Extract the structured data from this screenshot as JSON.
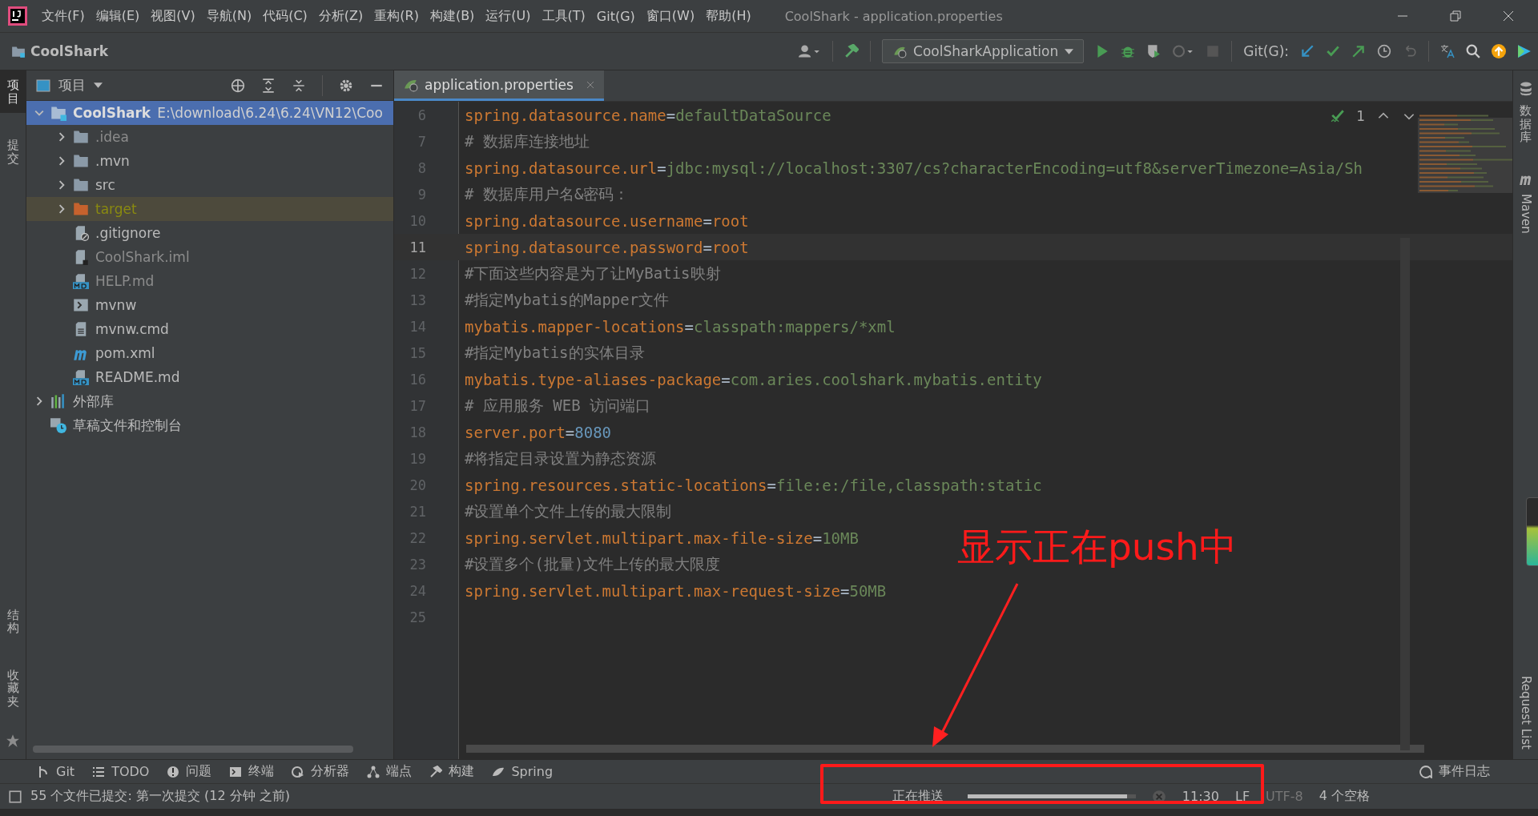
{
  "window": {
    "title": "CoolShark - application.properties"
  },
  "menu": [
    "文件(F)",
    "编辑(E)",
    "视图(V)",
    "导航(N)",
    "代码(C)",
    "分析(Z)",
    "重构(R)",
    "构建(B)",
    "运行(U)",
    "工具(T)",
    "Git(G)",
    "窗口(W)",
    "帮助(H)"
  ],
  "toolbar": {
    "project": "CoolShark",
    "run_config": "CoolSharkApplication",
    "git_label": "Git(G):"
  },
  "left_strip": {
    "top": [
      {
        "label": "项目",
        "selected": true
      },
      {
        "label": "提交",
        "selected": false
      }
    ],
    "bottom": [
      {
        "label": "结构",
        "selected": false
      },
      {
        "label": "收藏夹",
        "selected": false
      }
    ]
  },
  "project": {
    "title": "项目",
    "tree": [
      {
        "name": "CoolShark",
        "path": "E:\\download\\6.24\\6.24\\VN12\\Coo",
        "kind": "module",
        "dimmed": false,
        "selected": true,
        "expanded": true,
        "children": [
          {
            "name": ".idea",
            "kind": "folder",
            "dimmed": true,
            "selected": false,
            "expanded": false
          },
          {
            "name": ".mvn",
            "kind": "folder",
            "dimmed": false,
            "selected": false,
            "expanded": false
          },
          {
            "name": "src",
            "kind": "folder",
            "dimmed": false,
            "selected": false,
            "expanded": false
          },
          {
            "name": "target",
            "kind": "excluded",
            "dimmed": false,
            "selected": false,
            "expanded": false
          },
          {
            "name": ".gitignore",
            "kind": "gitignore",
            "dimmed": false,
            "selected": false
          },
          {
            "name": "CoolShark.iml",
            "kind": "iml",
            "dimmed": true,
            "selected": false
          },
          {
            "name": "HELP.md",
            "kind": "md",
            "dimmed": true,
            "selected": false
          },
          {
            "name": "mvnw",
            "kind": "shell",
            "dimmed": false,
            "selected": false
          },
          {
            "name": "mvnw.cmd",
            "kind": "text",
            "dimmed": false,
            "selected": false
          },
          {
            "name": "pom.xml",
            "kind": "maven",
            "dimmed": false,
            "selected": false
          },
          {
            "name": "README.md",
            "kind": "md",
            "dimmed": false,
            "selected": false
          }
        ]
      },
      {
        "name": "外部库",
        "kind": "library",
        "dimmed": false,
        "selected": false,
        "expanded": false
      },
      {
        "name": "草稿文件和控制台",
        "kind": "scratch",
        "dimmed": false,
        "selected": false
      }
    ]
  },
  "editor": {
    "tab": {
      "label": "application.properties",
      "selected": true
    },
    "inspection_count": "1",
    "lines": [
      {
        "number": "6",
        "current": false,
        "tokens": [
          {
            "kind": "key",
            "text": "spring.datasource.name"
          },
          {
            "kind": "sep",
            "text": "="
          },
          {
            "kind": "value",
            "text": "defaultDataSource"
          }
        ]
      },
      {
        "number": "7",
        "current": false,
        "tokens": [
          {
            "kind": "comment",
            "text": "# 数据库连接地址"
          }
        ]
      },
      {
        "number": "8",
        "current": false,
        "tokens": [
          {
            "kind": "key",
            "text": "spring.datasource.url"
          },
          {
            "kind": "sep",
            "text": "="
          },
          {
            "kind": "value",
            "text": "jdbc:mysql://localhost:3307/cs?characterEncoding=utf8&serverTimezone=Asia/Sh"
          }
        ]
      },
      {
        "number": "9",
        "current": false,
        "tokens": [
          {
            "kind": "comment",
            "text": "# 数据库用户名&密码："
          }
        ]
      },
      {
        "number": "10",
        "current": false,
        "tokens": [
          {
            "kind": "key",
            "text": "spring.datasource.username"
          },
          {
            "kind": "sep",
            "text": "="
          },
          {
            "kind": "reserved",
            "text": "root"
          }
        ]
      },
      {
        "number": "11",
        "current": true,
        "tokens": [
          {
            "kind": "key",
            "text": "spring.datasource.password"
          },
          {
            "kind": "sep",
            "text": "="
          },
          {
            "kind": "reserved",
            "text": "root"
          }
        ]
      },
      {
        "number": "12",
        "current": false,
        "tokens": [
          {
            "kind": "comment",
            "text": "#下面这些内容是为了让MyBatis映射"
          }
        ]
      },
      {
        "number": "13",
        "current": false,
        "tokens": [
          {
            "kind": "comment",
            "text": "#指定Mybatis的Mapper文件"
          }
        ]
      },
      {
        "number": "14",
        "current": false,
        "tokens": [
          {
            "kind": "key",
            "text": "mybatis.mapper-locations"
          },
          {
            "kind": "sep",
            "text": "="
          },
          {
            "kind": "value",
            "text": "classpath:mappers/*xml"
          }
        ]
      },
      {
        "number": "15",
        "current": false,
        "tokens": [
          {
            "kind": "comment",
            "text": "#指定Mybatis的实体目录"
          }
        ]
      },
      {
        "number": "16",
        "current": false,
        "tokens": [
          {
            "kind": "key",
            "text": "mybatis.type-aliases-package"
          },
          {
            "kind": "sep",
            "text": "="
          },
          {
            "kind": "value",
            "text": "com.aries.coolshark.mybatis.entity"
          }
        ]
      },
      {
        "number": "17",
        "current": false,
        "tokens": [
          {
            "kind": "comment",
            "text": "# 应用服务 WEB 访问端口"
          }
        ]
      },
      {
        "number": "18",
        "current": false,
        "tokens": [
          {
            "kind": "key",
            "text": "server.port"
          },
          {
            "kind": "sep",
            "text": "="
          },
          {
            "kind": "number",
            "text": "8080"
          }
        ]
      },
      {
        "number": "19",
        "current": false,
        "tokens": [
          {
            "kind": "comment",
            "text": "#将指定目录设置为静态资源"
          }
        ]
      },
      {
        "number": "20",
        "current": false,
        "tokens": [
          {
            "kind": "key",
            "text": "spring.resources.static-locations"
          },
          {
            "kind": "sep",
            "text": "="
          },
          {
            "kind": "value",
            "text": "file:e:/file,classpath:static"
          }
        ]
      },
      {
        "number": "21",
        "current": false,
        "tokens": [
          {
            "kind": "comment",
            "text": "#设置单个文件上传的最大限制"
          }
        ]
      },
      {
        "number": "22",
        "current": false,
        "tokens": [
          {
            "kind": "key",
            "text": "spring.servlet.multipart.max-file-size"
          },
          {
            "kind": "sep",
            "text": "="
          },
          {
            "kind": "value",
            "text": "10MB"
          }
        ]
      },
      {
        "number": "23",
        "current": false,
        "tokens": [
          {
            "kind": "comment",
            "text": "#设置多个(批量)文件上传的最大限度"
          }
        ]
      },
      {
        "number": "24",
        "current": false,
        "tokens": [
          {
            "kind": "key",
            "text": "spring.servlet.multipart.max-request-size"
          },
          {
            "kind": "sep",
            "text": "="
          },
          {
            "kind": "value",
            "text": "50MB"
          }
        ]
      },
      {
        "number": "25",
        "current": false
      }
    ]
  },
  "right_strip": [
    {
      "label": "数据库",
      "kind": "cjk"
    },
    {
      "label": "Maven",
      "kind": "latin"
    },
    {
      "label": "Request List",
      "kind": "latin"
    }
  ],
  "tool_windows": [
    {
      "label": "Git",
      "kind": "git"
    },
    {
      "label": "TODO",
      "kind": "todo"
    },
    {
      "label": "问题",
      "kind": "problems"
    },
    {
      "label": "终端",
      "kind": "terminal"
    },
    {
      "label": "分析器",
      "kind": "profiler"
    },
    {
      "label": "端点",
      "kind": "endpoints"
    },
    {
      "label": "构建",
      "kind": "build"
    },
    {
      "label": "Spring",
      "kind": "spring"
    }
  ],
  "event_log": "事件日志",
  "status_bar": {
    "message": "55 个文件已提交: 第一次提交 (12 分钟 之前)",
    "progress": {
      "label": "正在推送",
      "level": 0.95
    },
    "position": "11:30",
    "line_separator": "LF",
    "encoding": "UTF-8",
    "indent": "4 个空格"
  },
  "annotation": {
    "text": "显示正在push中"
  }
}
